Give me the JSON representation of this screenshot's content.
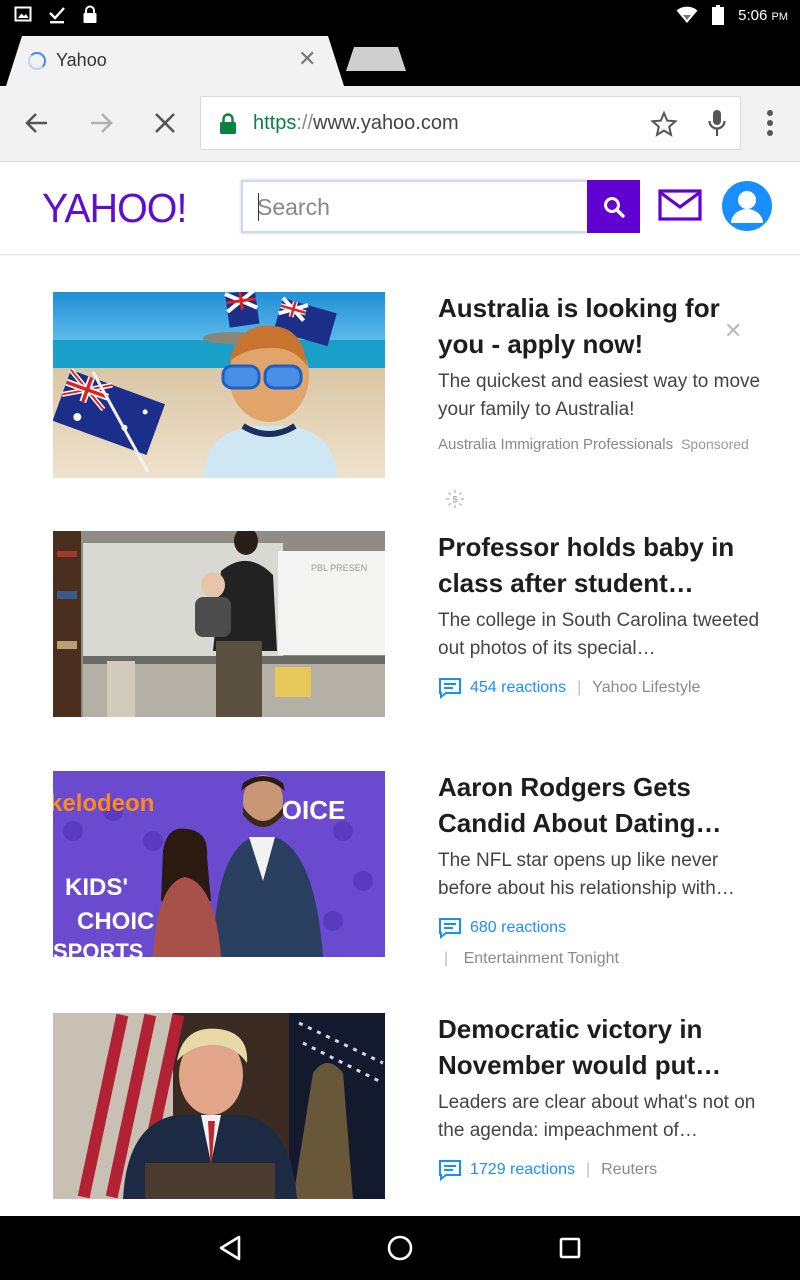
{
  "status_bar": {
    "time": "5:06",
    "ampm": "PM"
  },
  "browser": {
    "tab_title": "Yahoo",
    "url_scheme": "https",
    "url_sep": "://",
    "url_host": "www.yahoo.com"
  },
  "yahoo": {
    "logo": "YAHOO!",
    "search_placeholder": "Search",
    "brand_color": "#6001d2"
  },
  "ad": {
    "title": "Australia is looking for you - apply now!",
    "summary": "The quickest and easiest way to move your family to Australia!",
    "advertiser": "Australia Immigration Professionals",
    "sponsored_label": "Sponsored"
  },
  "stories": [
    {
      "title": "Professor holds baby in class after student…",
      "summary": "The college in South Carolina tweeted out photos of its special…",
      "reactions": "454 reactions",
      "source": "Yahoo Lifestyle",
      "slide_text": "PBL PRESEN"
    },
    {
      "title": "Aaron Rodgers Gets Candid About Dating…",
      "summary": "The NFL star opens up like never before about his relationship with…",
      "reactions": "680 reactions",
      "source": "Entertainment Tonight",
      "backdrop_words": [
        "kelodeon",
        "KIDS'",
        "CHOIC",
        "HOICE",
        "SPORTS"
      ]
    },
    {
      "title": "Democratic victory in November would put…",
      "summary": "Leaders are clear about what's not on the agenda: impeachment of…",
      "reactions": "1729 reactions",
      "source": "Reuters"
    }
  ],
  "meta_separator": "|"
}
